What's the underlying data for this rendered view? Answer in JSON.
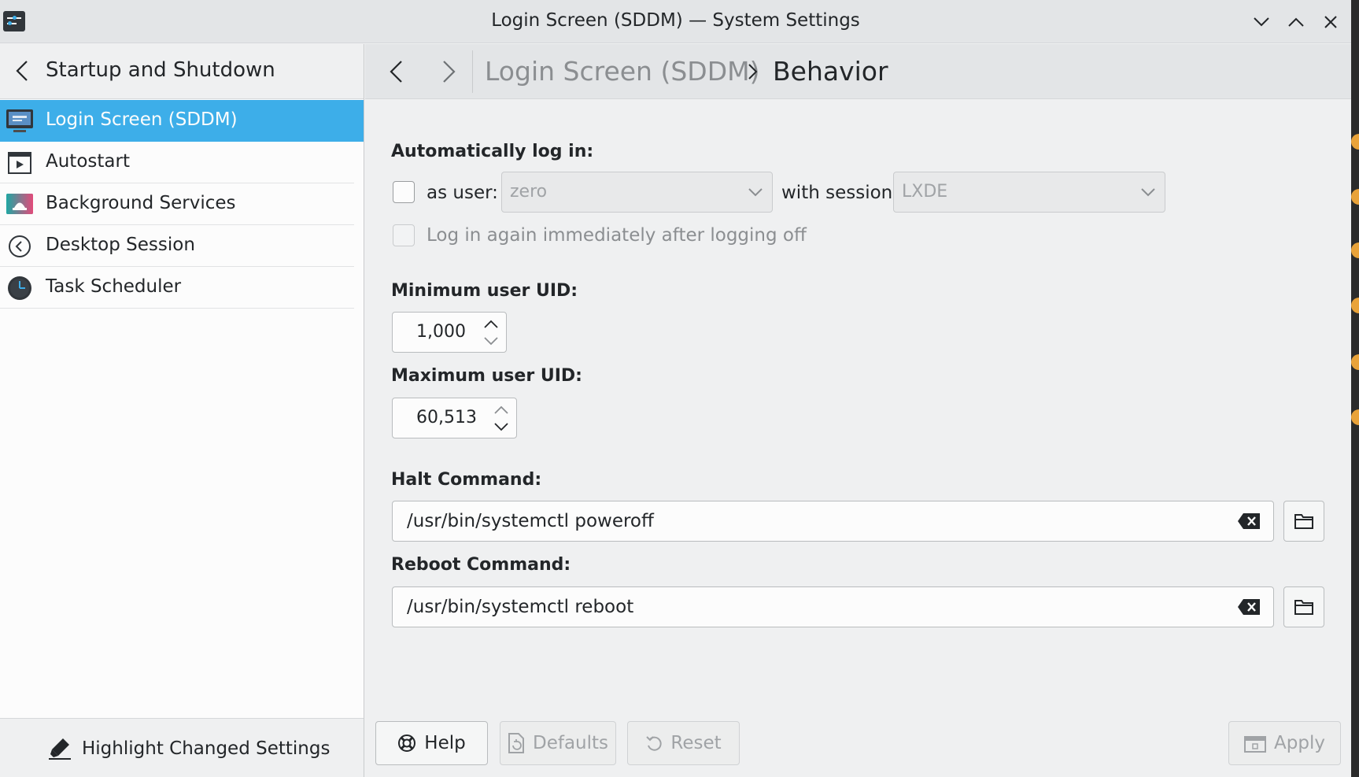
{
  "window": {
    "title": "Login Screen (SDDM) — System Settings"
  },
  "sidebar": {
    "header_title": "Startup and Shutdown",
    "items": [
      {
        "label": "Login Screen (SDDM)",
        "icon": "monitor-icon",
        "selected": true
      },
      {
        "label": "Autostart",
        "icon": "autostart-icon",
        "selected": false
      },
      {
        "label": "Background Services",
        "icon": "background-services-icon",
        "selected": false
      },
      {
        "label": "Desktop Session",
        "icon": "desktop-session-icon",
        "selected": false
      },
      {
        "label": "Task Scheduler",
        "icon": "clock-icon",
        "selected": false
      }
    ],
    "footer_label": "Highlight Changed Settings"
  },
  "breadcrumb": {
    "parent": "Login Screen (SDDM)",
    "current": "Behavior"
  },
  "form": {
    "autologin_label": "Automatically log in:",
    "as_user_label": "as user:",
    "user_value": "zero",
    "with_session_label": "with session",
    "session_value": "LXDE",
    "relogin_label": "Log in again immediately after logging off",
    "min_uid_label": "Minimum user UID:",
    "min_uid_value": "1,000",
    "max_uid_label": "Maximum user UID:",
    "max_uid_value": "60,513",
    "halt_label": "Halt Command:",
    "halt_value": "/usr/bin/systemctl poweroff",
    "reboot_label": "Reboot Command:",
    "reboot_value": "/usr/bin/systemctl reboot"
  },
  "buttons": {
    "help": "Help",
    "defaults": "Defaults",
    "reset": "Reset",
    "apply": "Apply"
  },
  "colors": {
    "accent": "#3daee9",
    "window_bg": "#eff0f1",
    "text": "#232629"
  }
}
